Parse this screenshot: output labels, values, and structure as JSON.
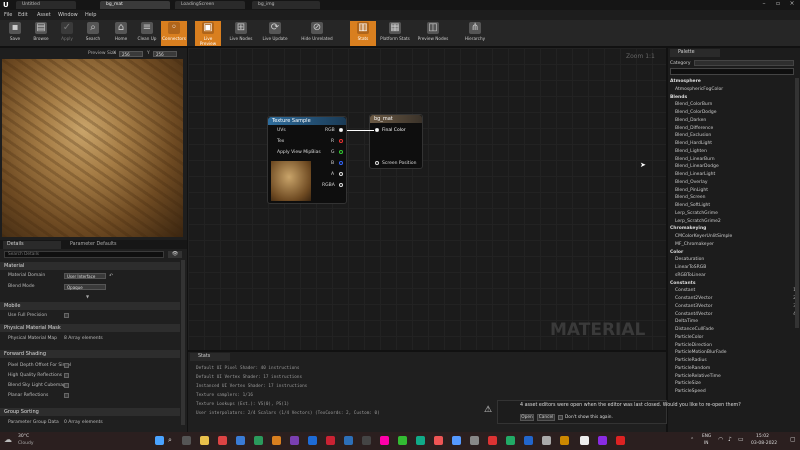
{
  "window": {
    "tabs": [
      {
        "label": "Untitled"
      },
      {
        "label": "bg_mat"
      },
      {
        "label": "LoadingScreen"
      },
      {
        "label": "bg_img"
      }
    ],
    "app_letter": "U"
  },
  "menu": {
    "items": [
      "File",
      "Edit",
      "Asset",
      "Window",
      "Help"
    ]
  },
  "toolbar": {
    "buttons": [
      {
        "label": "Save",
        "icon": "save-icon"
      },
      {
        "label": "Browse",
        "icon": "browse-icon"
      },
      {
        "label": "Apply",
        "icon": "apply-icon"
      },
      {
        "label": "Search",
        "icon": "search-icon"
      },
      {
        "label": "Home",
        "icon": "home-icon"
      },
      {
        "label": "Clean Up",
        "icon": "cleanup-icon"
      },
      {
        "label": "Connectors",
        "icon": "connectors-icon"
      },
      {
        "label": "Live Preview",
        "icon": "live-preview-icon"
      },
      {
        "label": "Live Nodes",
        "icon": "live-nodes-icon"
      },
      {
        "label": "Live Update",
        "icon": "live-update-icon"
      },
      {
        "label": "Hide Unrelated",
        "icon": "hide-unrelated-icon"
      },
      {
        "label": "Stats",
        "icon": "stats-icon"
      },
      {
        "label": "Platform Stats",
        "icon": "platform-stats-icon"
      },
      {
        "label": "Preview Nodes",
        "icon": "preview-nodes-icon"
      },
      {
        "label": "Hierarchy",
        "icon": "hierarchy-icon"
      }
    ],
    "accent": "#d97f1f"
  },
  "preview": {
    "label": "Preview Size",
    "x_value": "256",
    "y_value": "256",
    "x_label": "X",
    "y_label": "Y"
  },
  "details": {
    "tabs": [
      {
        "label": "Details"
      },
      {
        "label": "Parameter Defaults"
      }
    ],
    "search_placeholder": "Search Details",
    "sections": {
      "material": "Material",
      "mobile": "Mobile",
      "physical": "Physical Material Mask",
      "forward": "Forward Shading",
      "group": "Group Sorting"
    },
    "props": {
      "material_domain": "Material Domain",
      "material_domain_value": "User Interface",
      "blend_mode": "Blend Mode",
      "blend_mode_value": "Opaque",
      "use_full_precision": "Use Full Precision",
      "physical_mask": "Physical Material Map",
      "physical_mask_value": "8 Array elements",
      "fwd1": "Pixel Depth Offset For Simpl",
      "fwd2": "High Quality Reflections",
      "fwd3": "Blend Sky Light Cubemaps",
      "fwd4": "Planar Reflections",
      "group_order": "Parameter Group Data",
      "group_order_value": "0 Array elements"
    }
  },
  "graph": {
    "zoom": "Zoom 1:1",
    "watermark": "MATERIAL",
    "texture_node": {
      "title": "Texture Sample",
      "pins_in": [
        "UVs",
        "Tex",
        "Apply View MipBias"
      ],
      "pins_out": [
        "RGB",
        "R",
        "G",
        "B",
        "A",
        "RGBA"
      ]
    },
    "material_node": {
      "title": "bg_mat",
      "pins": [
        "Final Color",
        "Screen Position"
      ]
    }
  },
  "stats": {
    "title": "Stats",
    "lines": [
      "Default UI Pixel Shader: 40 instructions",
      "Default UI Vertex Shader: 17 instructions",
      "Instanced UI Vertex Shader: 17 instructions",
      "Texture samplers: 1/16",
      "Texture Lookups (Est.): VS(0), PS(1)",
      "User interpolators: 2/4 Scalars (1/4 Vectors) (TexCoords: 2, Custom: 0)"
    ]
  },
  "palette": {
    "title": "Palette",
    "category_label": "Category",
    "entries": [
      {
        "kind": "cat",
        "label": "Atmosphere"
      },
      {
        "kind": "item",
        "label": "AtmosphericFogColor"
      },
      {
        "kind": "cat",
        "label": "Blends"
      },
      {
        "kind": "item",
        "label": "Blend_ColorBurn"
      },
      {
        "kind": "item",
        "label": "Blend_ColorDodge"
      },
      {
        "kind": "item",
        "label": "Blend_Darken"
      },
      {
        "kind": "item",
        "label": "Blend_Difference"
      },
      {
        "kind": "item",
        "label": "Blend_Exclusion"
      },
      {
        "kind": "item",
        "label": "Blend_HardLight"
      },
      {
        "kind": "item",
        "label": "Blend_Lighten"
      },
      {
        "kind": "item",
        "label": "Blend_LinearBurn"
      },
      {
        "kind": "item",
        "label": "Blend_LinearDodge"
      },
      {
        "kind": "item",
        "label": "Blend_LinearLight"
      },
      {
        "kind": "item",
        "label": "Blend_Overlay"
      },
      {
        "kind": "item",
        "label": "Blend_PinLight"
      },
      {
        "kind": "item",
        "label": "Blend_Screen"
      },
      {
        "kind": "item",
        "label": "Blend_SoftLight"
      },
      {
        "kind": "item",
        "label": "Lerp_ScratchGrime"
      },
      {
        "kind": "item",
        "label": "Lerp_ScratchGrime2"
      },
      {
        "kind": "cat",
        "label": "Chromakeying"
      },
      {
        "kind": "item",
        "label": "CMColorKeyerUnlitSimple"
      },
      {
        "kind": "item",
        "label": "MF_Chromakeyer"
      },
      {
        "kind": "cat",
        "label": "Color"
      },
      {
        "kind": "item",
        "label": "Desaturation"
      },
      {
        "kind": "item",
        "label": "LinearToSRGB"
      },
      {
        "kind": "item",
        "label": "sRGBToLinear"
      },
      {
        "kind": "cat",
        "label": "Constants"
      },
      {
        "kind": "item",
        "label": "Constant",
        "num": "1"
      },
      {
        "kind": "item",
        "label": "Constant2Vector",
        "num": "2"
      },
      {
        "kind": "item",
        "label": "Constant3Vector",
        "num": "3"
      },
      {
        "kind": "item",
        "label": "Constant4Vector",
        "num": "4"
      },
      {
        "kind": "item",
        "label": "DeltaTime"
      },
      {
        "kind": "item",
        "label": "DistanceCullFade"
      },
      {
        "kind": "item",
        "label": "ParticleColor"
      },
      {
        "kind": "item",
        "label": "ParticleDirection"
      },
      {
        "kind": "item",
        "label": "ParticleMotionBlurFade"
      },
      {
        "kind": "item",
        "label": "ParticleRadius"
      },
      {
        "kind": "item",
        "label": "ParticleRandom"
      },
      {
        "kind": "item",
        "label": "ParticleRelativeTime"
      },
      {
        "kind": "item",
        "label": "ParticleSize"
      },
      {
        "kind": "item",
        "label": "ParticleSpeed"
      }
    ]
  },
  "notification": {
    "message": "4 asset editors were open when the editor was last closed. Would you like to re-open them?",
    "open": "Open",
    "cancel": "Cancel",
    "dont_show": "Don't show this again."
  },
  "taskbar": {
    "temp": "30°C",
    "weather": "Cloudy",
    "search_placeholder": "Search",
    "lang1": "ENG",
    "lang2": "IN",
    "time": "15:02",
    "date": "03-08-2022"
  }
}
